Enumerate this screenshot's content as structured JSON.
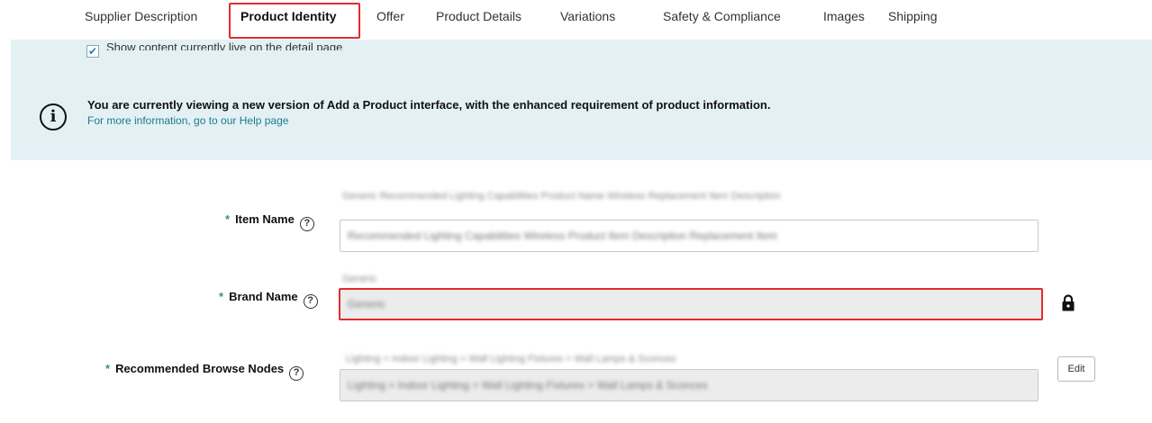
{
  "tabs": [
    {
      "label": "Supplier Description"
    },
    {
      "label": "Product Identity",
      "active": true
    },
    {
      "label": "Offer"
    },
    {
      "label": "Product Details"
    },
    {
      "label": "Variations"
    },
    {
      "label": "Safety & Compliance"
    },
    {
      "label": "Images"
    },
    {
      "label": "Shipping"
    }
  ],
  "banner": {
    "checkbox_label": "Show content currently live on the detail page",
    "checkbox_checked": true,
    "message": "You are currently viewing a new version of Add a Product interface, with the enhanced requirement of product information.",
    "help_link": "For more information, go to our Help page"
  },
  "form": {
    "required_marker": "*",
    "help_glyph": "?",
    "item_name": {
      "label": "Item Name",
      "suggestion": "Generic Recommended Lighting Capabilities Product Name Wireless Replacement Item Description",
      "value": "Recommended Lighting Capabilities Wireless Product Item Description Replacement Item"
    },
    "brand_name": {
      "label": "Brand Name",
      "suggestion": "Generic",
      "value": "Generic"
    },
    "browse_nodes": {
      "label": "Recommended Browse Nodes",
      "suggestion": "Lighting > Indoor Lighting > Wall Lighting Fixtures > Wall Lamps & Sconces",
      "value": "Lighting > Indoor Lighting > Wall Lighting Fixtures > Wall Lamps & Sconces",
      "edit_label": "Edit"
    }
  },
  "colors": {
    "highlight": "#e12c2c",
    "banner_bg": "#e3f1f5",
    "link": "#1f7a8c",
    "required": "#2e9b63"
  }
}
